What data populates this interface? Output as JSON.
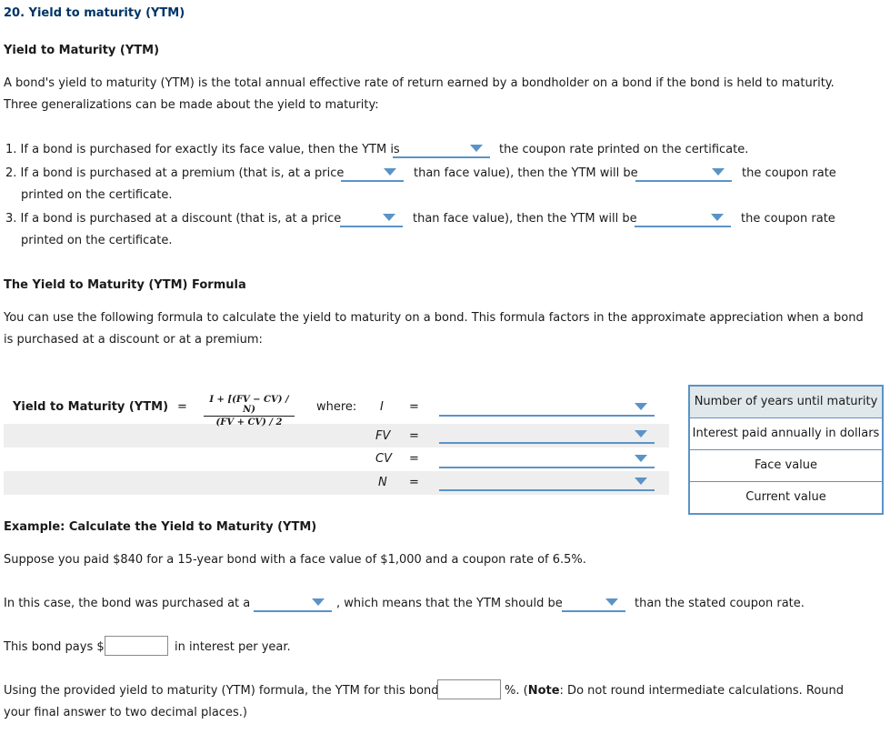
{
  "question": {
    "number_title": "20. Yield to maturity (YTM)"
  },
  "intro": {
    "heading": "Yield to Maturity (YTM)",
    "paragraph_line1": "A bond's yield to maturity (YTM) is the total annual effective rate of return earned by a bondholder on a bond if the bond is held to maturity.",
    "paragraph_line2": "Three generalizations can be made about the yield to maturity:"
  },
  "generalizations": [
    {
      "text_before": "1. If a bond is purchased for exactly its face value, then the YTM is",
      "dropdown1_value": "",
      "text_after": "the coupon rate printed on the certificate."
    },
    {
      "text_before": "2. If a bond is purchased at a premium (that is, at a price",
      "dropdown1_value": "",
      "text_middle": "than face value), then the YTM will be",
      "dropdown2_value": "",
      "text_after": "the coupon rate",
      "continuation": "printed on the certificate."
    },
    {
      "text_before": "3. If a bond is purchased at a discount (that is, at a price",
      "dropdown1_value": "",
      "text_middle": "than face value), then the YTM will be",
      "dropdown2_value": "",
      "text_after": "the coupon rate",
      "continuation": "printed on the certificate."
    }
  ],
  "formula_section": {
    "heading": "The Yield to Maturity (YTM) Formula",
    "paragraph_line1": "You can use the following formula to calculate the yield to maturity on a bond. This formula factors in the approximate appreciation when a bond",
    "paragraph_line2": "is purchased at a discount or at a premium:",
    "label": "Yield to Maturity (YTM)",
    "equals": "=",
    "numerator": "I + [(FV − CV) / N)",
    "denominator": "(FV + CV) / 2",
    "where_label": "where:",
    "variables": [
      {
        "symbol": "I",
        "equals": "=",
        "value": ""
      },
      {
        "symbol": "FV",
        "equals": "=",
        "value": ""
      },
      {
        "symbol": "CV",
        "equals": "=",
        "value": ""
      },
      {
        "symbol": "N",
        "equals": "=",
        "value": ""
      }
    ],
    "answer_choices": [
      "Number of years until maturity",
      "Interest paid annually in dollars",
      "Face value",
      "Current value"
    ]
  },
  "example": {
    "heading": "Example: Calculate the Yield to Maturity (YTM)",
    "scenario": "Suppose you paid $840 for a 15-year bond with a face value of $1,000 and a coupon rate of 6.5%.",
    "case_before": "In this case, the bond was purchased at a",
    "case_dropdown1_value": "",
    "case_middle": ", which means that the YTM should be",
    "case_dropdown2_value": "",
    "case_after": "than the stated coupon rate.",
    "interest_before": "This bond pays $",
    "interest_value": "",
    "interest_after": "in interest per year.",
    "ytm_before": "Using the provided yield to maturity (YTM) formula, the YTM for this bond is",
    "ytm_value": "",
    "ytm_after_pct": "%. (",
    "note_label": "Note",
    "note_text": ": Do not round intermediate calculations. Round",
    "note_line2": "your final answer to two decimal places.)"
  }
}
